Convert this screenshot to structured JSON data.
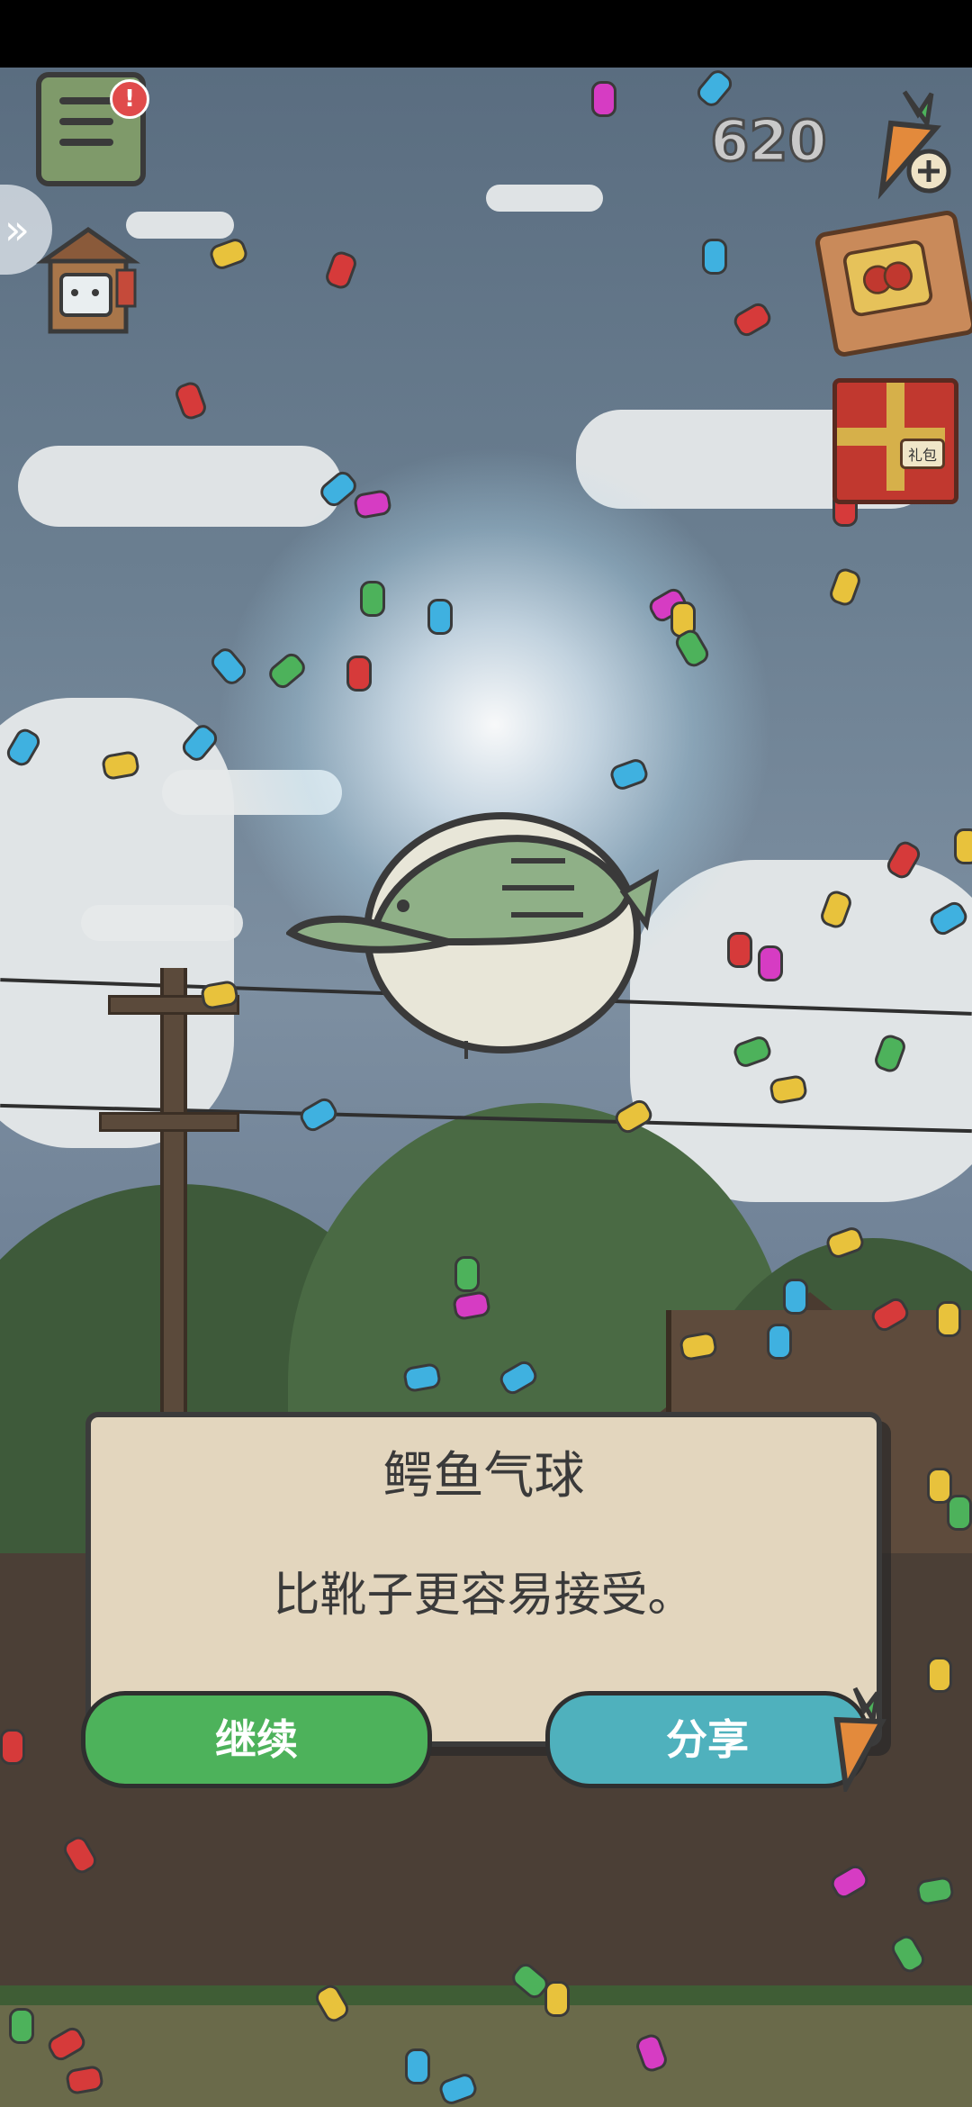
{
  "hud": {
    "currency_count": "620",
    "book_icon": "journal-book-icon",
    "alert_badge": "!",
    "expand_icon": "chevron-right-icon",
    "carrot_shop_icon": "carrot-plus-icon",
    "ticket_icon": "lottery-ticket-icon",
    "gift_icon": "gift-box-icon",
    "gift_tag": "礼包"
  },
  "dialog": {
    "title": "鳄鱼气球",
    "message": "比靴子更容易接受。"
  },
  "buttons": {
    "continue_label": "继续",
    "share_label": "分享"
  },
  "colors": {
    "continue_bg": "#4db25b",
    "share_bg": "#4fb1bd",
    "dialog_bg": "#e3d6be"
  }
}
